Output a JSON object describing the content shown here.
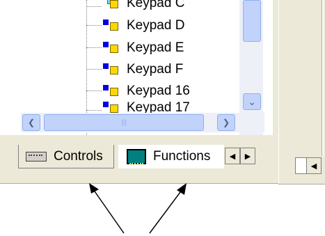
{
  "tree": {
    "items": [
      {
        "label": "Keypad C"
      },
      {
        "label": "Keypad D"
      },
      {
        "label": "Keypad E"
      },
      {
        "label": "Keypad F"
      },
      {
        "label": "Keypad 16"
      },
      {
        "label": "Keypad 17"
      }
    ]
  },
  "tabs": {
    "controls_label": "Controls",
    "functions_label": "Functions"
  },
  "colors": {
    "panel": "#ece9d8",
    "scroll_thumb": "#c1d3fb",
    "node_blue": "#0000e0",
    "node_yellow": "#ffd800"
  }
}
